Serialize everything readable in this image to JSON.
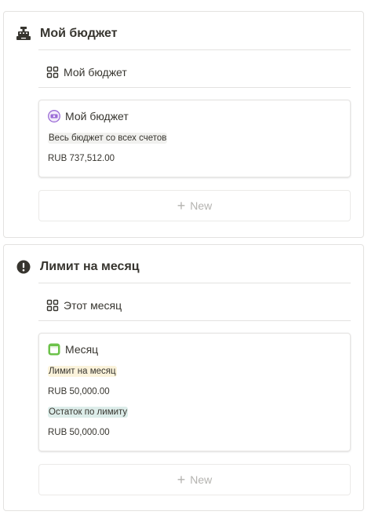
{
  "budget_section": {
    "title": "Мой бюджет",
    "icon": "cash-register-icon",
    "view_title": "Мой бюджет",
    "card": {
      "title": "Мой бюджет",
      "icon": "money-icon",
      "icon_color": "#9b6bd6",
      "property_label": "Весь бюджет со всех счетов",
      "property_label_bg": "#f1f1ef",
      "value": "RUB 737,512.00"
    },
    "new_label": "New"
  },
  "limit_section": {
    "title": "Лимит на месяц",
    "icon": "exclamation-circle-icon",
    "view_title": "Этот месяц",
    "card": {
      "title": "Месяц",
      "icon": "calendar-icon",
      "icon_color": "#6cc24a",
      "properties": [
        {
          "label": "Лимит на месяц",
          "label_bg": "#fbf3db",
          "value": "RUB 50,000.00"
        },
        {
          "label": "Остаток по лимиту",
          "label_bg": "#ddedea",
          "value": "RUB 50,000.00"
        }
      ]
    },
    "new_label": "New"
  }
}
